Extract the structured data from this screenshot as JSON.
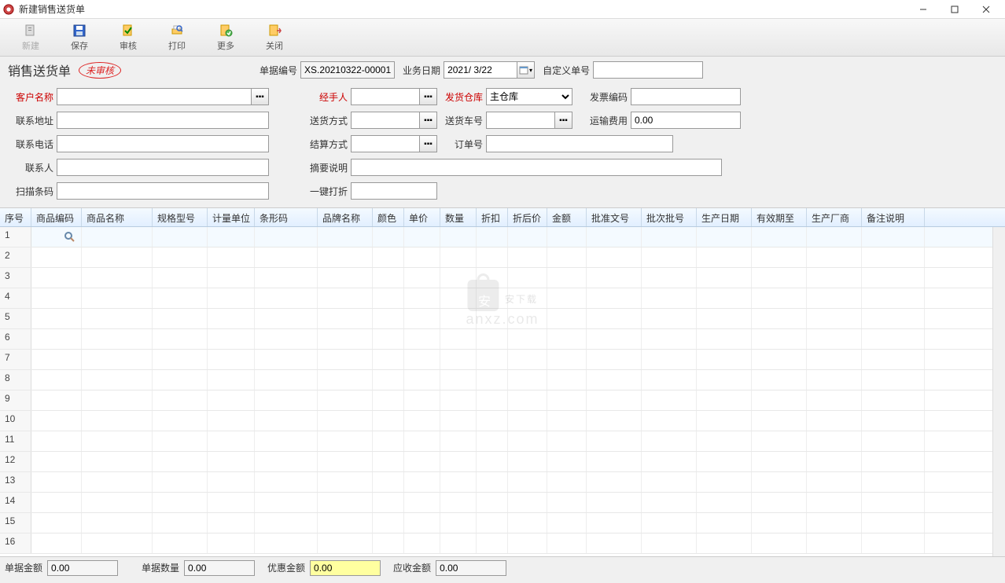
{
  "window": {
    "title": "新建销售送货单"
  },
  "toolbar": {
    "new": "新建",
    "save": "保存",
    "audit": "审核",
    "print": "打印",
    "more": "更多",
    "close": "关闭"
  },
  "header": {
    "doc_title": "销售送货单",
    "stamp": "未审核",
    "doc_no_label": "单据编号",
    "doc_no": "XS.20210322-00001",
    "biz_date_label": "业务日期",
    "biz_date": "2021/ 3/22",
    "custom_no_label": "自定义单号",
    "custom_no": ""
  },
  "form": {
    "customer_label": "客户名称",
    "customer": "",
    "handler_label": "经手人",
    "handler": "",
    "warehouse_label": "发货仓库",
    "warehouse": "主仓库",
    "invoice_no_label": "发票编码",
    "invoice_no": "",
    "address_label": "联系地址",
    "address": "",
    "ship_method_label": "送货方式",
    "ship_method": "",
    "vehicle_label": "送货车号",
    "vehicle": "",
    "ship_fee_label": "运输费用",
    "ship_fee": "0.00",
    "phone_label": "联系电话",
    "phone": "",
    "settle_label": "结算方式",
    "settle": "",
    "order_no_label": "订单号",
    "order_no": "",
    "contact_label": "联系人",
    "contact": "",
    "summary_label": "摘要说明",
    "summary": "",
    "barcode_label": "扫描条码",
    "barcode": "",
    "discount_label": "一键打折",
    "discount": ""
  },
  "grid": {
    "cols": [
      "序号",
      "商品编码",
      "商品名称",
      "规格型号",
      "计量单位",
      "条形码",
      "品牌名称",
      "颜色",
      "单价",
      "数量",
      "折扣",
      "折后价",
      "金额",
      "批准文号",
      "批次批号",
      "生产日期",
      "有效期至",
      "生产厂商",
      "备注说明"
    ],
    "rows": 16
  },
  "footer": {
    "amount_label": "单据金额",
    "amount": "0.00",
    "qty_label": "单据数量",
    "qty": "0.00",
    "disc_label": "优惠金额",
    "disc": "0.00",
    "recv_label": "应收金额",
    "recv": "0.00"
  },
  "watermark": {
    "line1": "安下载",
    "line2": "anxz.com"
  }
}
